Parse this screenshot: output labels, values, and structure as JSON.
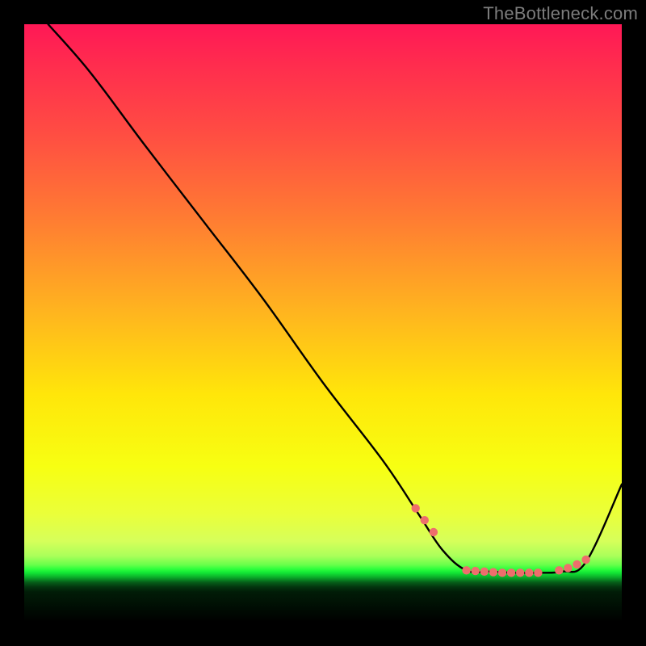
{
  "watermark": "TheBottleneck.com",
  "chart_data": {
    "type": "line",
    "title": "",
    "xlabel": "",
    "ylabel": "",
    "xlim": [
      0,
      100
    ],
    "ylim": [
      0,
      100
    ],
    "grid": false,
    "legend": false,
    "series": [
      {
        "name": "bottleneck-curve",
        "x": [
          4,
          11,
          20,
          30,
          40,
          50,
          60,
          66,
          70,
          74,
          78,
          82,
          86,
          90,
          94,
          100
        ],
        "y": [
          100,
          92,
          80,
          67,
          54,
          40,
          27,
          18,
          12,
          8.6,
          8.4,
          8.2,
          8.2,
          8.4,
          10,
          23
        ]
      }
    ],
    "markers": {
      "name": "highlight-dots",
      "color": "#ee6e6c",
      "x": [
        65.5,
        67.0,
        68.5,
        74.0,
        75.5,
        77.0,
        78.5,
        80.0,
        81.5,
        83.0,
        84.5,
        86.0,
        89.5,
        91.0,
        92.5,
        94.0
      ],
      "y": [
        19.0,
        17.0,
        15.0,
        8.6,
        8.5,
        8.4,
        8.3,
        8.2,
        8.2,
        8.2,
        8.2,
        8.2,
        8.6,
        9.0,
        9.6,
        10.4
      ]
    }
  }
}
